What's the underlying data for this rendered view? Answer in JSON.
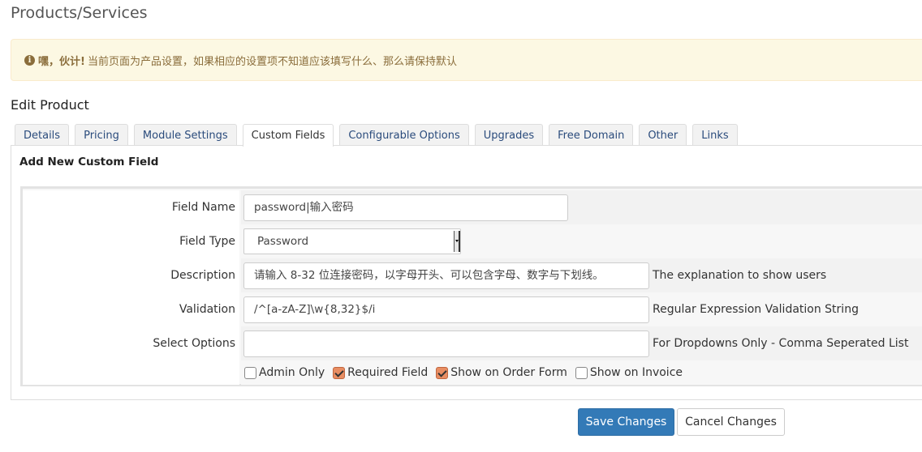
{
  "page": {
    "title": "Products/Services"
  },
  "alert": {
    "icon": "info-circle-icon",
    "strong": "嘿，伙计!",
    "text": "当前页面为产品设置，如果相应的设置项不知道应该填写什么、那么请保持默认"
  },
  "section": {
    "title": "Edit Product"
  },
  "tabs": [
    {
      "label": "Details",
      "active": false
    },
    {
      "label": "Pricing",
      "active": false
    },
    {
      "label": "Module Settings",
      "active": false
    },
    {
      "label": "Custom Fields",
      "active": true
    },
    {
      "label": "Configurable Options",
      "active": false
    },
    {
      "label": "Upgrades",
      "active": false
    },
    {
      "label": "Free Domain",
      "active": false
    },
    {
      "label": "Other",
      "active": false
    },
    {
      "label": "Links",
      "active": false
    }
  ],
  "panel": {
    "heading": "Add New Custom Field"
  },
  "form": {
    "field_name": {
      "label": "Field Name",
      "value": "password|输入密码"
    },
    "field_type": {
      "label": "Field Type",
      "value": "Password"
    },
    "description": {
      "label": "Description",
      "value": "请输入 8-32 位连接密码，以字母开头、可以包含字母、数字与下划线。",
      "hint": "The explanation to show users"
    },
    "validation": {
      "label": "Validation",
      "value": "/^[a-zA-Z]\\w{8,32}$/i",
      "hint": "Regular Expression Validation String"
    },
    "select_options": {
      "label": "Select Options",
      "value": "",
      "hint": "For Dropdowns Only - Comma Seperated List"
    },
    "checkboxes": [
      {
        "label": "Admin Only",
        "checked": false
      },
      {
        "label": "Required Field",
        "checked": true
      },
      {
        "label": "Show on Order Form",
        "checked": true
      },
      {
        "label": "Show on Invoice",
        "checked": false
      }
    ]
  },
  "buttons": {
    "save": "Save Changes",
    "cancel": "Cancel Changes"
  },
  "colors": {
    "primary": "#337ab7",
    "alert_bg": "#fcf8e3",
    "alert_text": "#8a6d3b",
    "checkbox_on": "#e88d62"
  }
}
